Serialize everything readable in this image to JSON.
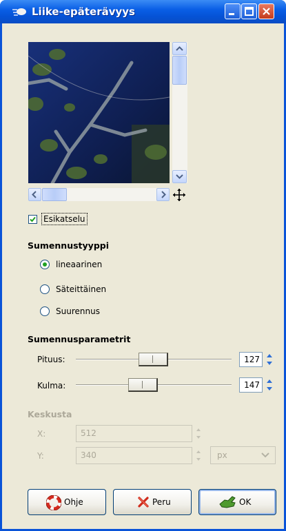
{
  "window": {
    "title": "Liike-epäterävyys"
  },
  "preview": {
    "show_preview_label": "Esikatselu",
    "show_preview_checked": true
  },
  "blur_type": {
    "heading": "Sumennustyyppi",
    "options": [
      {
        "label": "lineaarinen",
        "selected": true
      },
      {
        "label": "Säteittäinen",
        "selected": false
      },
      {
        "label": "Suurennus",
        "selected": false
      }
    ]
  },
  "blur_params": {
    "heading": "Sumennusparametrit",
    "length": {
      "label": "Pituus:",
      "value": "127"
    },
    "angle": {
      "label": "Kulma:",
      "value": "147"
    }
  },
  "center": {
    "heading": "Keskusta",
    "x": {
      "label": "X:",
      "value": "512"
    },
    "y": {
      "label": "Y:",
      "value": "340"
    },
    "unit": "px"
  },
  "buttons": {
    "help": "Ohje",
    "cancel": "Peru",
    "ok": "OK"
  },
  "colors": {
    "titlebar": "#0a5fe6",
    "dialog_bg": "#ece9d8",
    "radio_dot": "#21a121"
  }
}
